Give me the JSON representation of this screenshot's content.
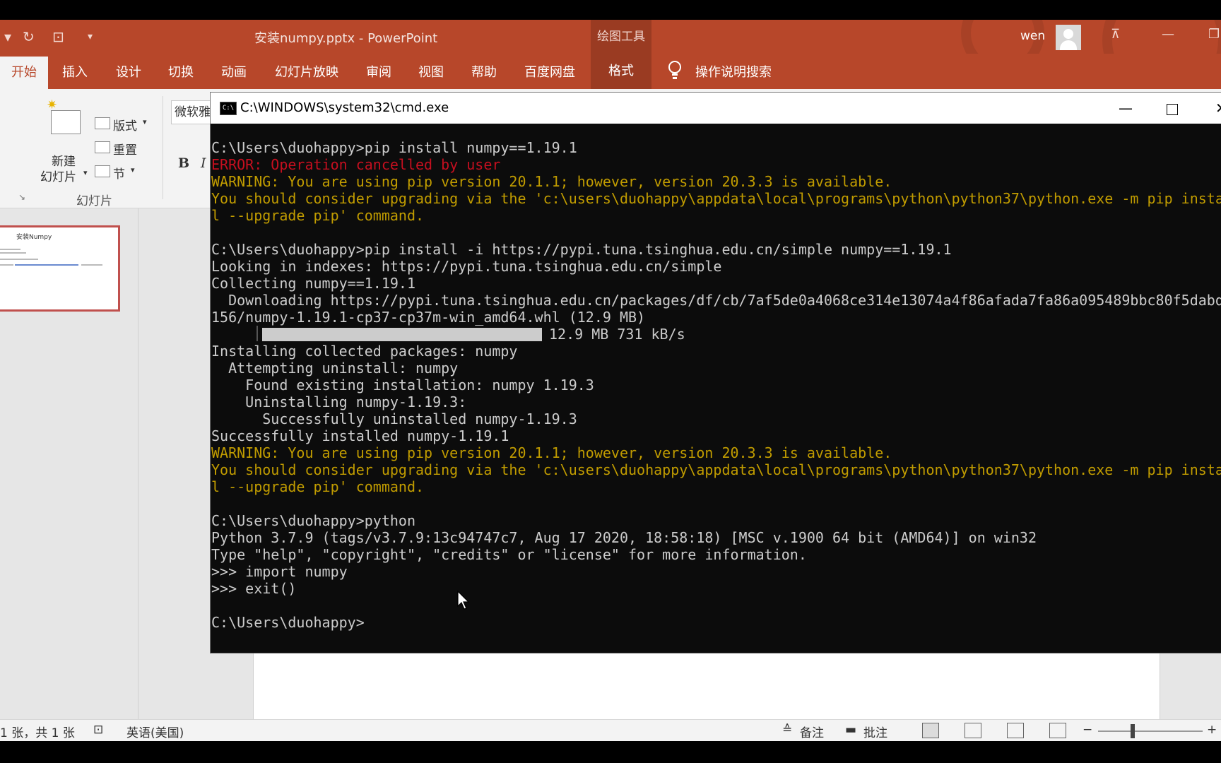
{
  "titlebar": {
    "document_title": "安装numpy.pptx  -  PowerPoint",
    "context_tool": "绘图工具",
    "user": "wen"
  },
  "ribbon_tabs": [
    "开始",
    "插入",
    "设计",
    "切换",
    "动画",
    "幻灯片放映",
    "审阅",
    "视图",
    "帮助",
    "百度网盘",
    "格式"
  ],
  "search_label": "操作说明搜索",
  "ribbon": {
    "new_slide_line1": "新建",
    "new_slide_line2": "幻灯片",
    "layout": "版式",
    "reset": "重置",
    "section": "节",
    "group_slides": "幻灯片",
    "font_name": "微软雅黑",
    "bold": "B",
    "italic": "I"
  },
  "thumbnail": {
    "title": "安装Numpy"
  },
  "statusbar": {
    "slide_count": "1 张，共 1 张",
    "language": "英语(美国)",
    "notes": "备注",
    "comments": "批注",
    "zoom_minus": "−",
    "zoom_plus": "+"
  },
  "cmd": {
    "title": "C:\\WINDOWS\\system32\\cmd.exe",
    "lines": [
      {
        "text": "C:\\Users\\duohappy>pip install numpy==1.19.1",
        "style": "normal"
      },
      {
        "text": "ERROR: Operation cancelled by user",
        "style": "err"
      },
      {
        "text": "WARNING: You are using pip version 20.1.1; however, version 20.3.3 is available.",
        "style": "warn"
      },
      {
        "text": "You should consider upgrading via the 'c:\\users\\duohappy\\appdata\\local\\programs\\python\\python37\\python.exe -m pip insta",
        "style": "warn"
      },
      {
        "text": "l --upgrade pip' command.",
        "style": "warn"
      },
      {
        "text": "",
        "style": "normal"
      },
      {
        "text": "C:\\Users\\duohappy>pip install -i https://pypi.tuna.tsinghua.edu.cn/simple numpy==1.19.1",
        "style": "normal"
      },
      {
        "text": "Looking in indexes: https://pypi.tuna.tsinghua.edu.cn/simple",
        "style": "normal"
      },
      {
        "text": "Collecting numpy==1.19.1",
        "style": "normal"
      },
      {
        "text": "  Downloading https://pypi.tuna.tsinghua.edu.cn/packages/df/cb/7af5de0a4068ce314e13074a4f86afada7fa86a095489bbc80f5dabd",
        "style": "normal"
      },
      {
        "text": "156/numpy-1.19.1-cp37-cp37m-win_amd64.whl (12.9 MB)",
        "style": "normal"
      },
      {
        "text": "",
        "style": "progress"
      },
      {
        "text": "Installing collected packages: numpy",
        "style": "normal"
      },
      {
        "text": "  Attempting uninstall: numpy",
        "style": "normal"
      },
      {
        "text": "    Found existing installation: numpy 1.19.3",
        "style": "normal"
      },
      {
        "text": "    Uninstalling numpy-1.19.3:",
        "style": "normal"
      },
      {
        "text": "      Successfully uninstalled numpy-1.19.3",
        "style": "normal"
      },
      {
        "text": "Successfully installed numpy-1.19.1",
        "style": "normal"
      },
      {
        "text": "WARNING: You are using pip version 20.1.1; however, version 20.3.3 is available.",
        "style": "warn"
      },
      {
        "text": "You should consider upgrading via the 'c:\\users\\duohappy\\appdata\\local\\programs\\python\\python37\\python.exe -m pip insta",
        "style": "warn"
      },
      {
        "text": "l --upgrade pip' command.",
        "style": "warn"
      },
      {
        "text": "",
        "style": "normal"
      },
      {
        "text": "C:\\Users\\duohappy>python",
        "style": "normal"
      },
      {
        "text": "Python 3.7.9 (tags/v3.7.9:13c94747c7, Aug 17 2020, 18:58:18) [MSC v.1900 64 bit (AMD64)] on win32",
        "style": "normal"
      },
      {
        "text": "Type \"help\", \"copyright\", \"credits\" or \"license\" for more information.",
        "style": "normal"
      },
      {
        "text": ">>> import numpy",
        "style": "normal"
      },
      {
        "text": ">>> exit()",
        "style": "normal"
      },
      {
        "text": "",
        "style": "normal"
      },
      {
        "text": "C:\\Users\\duohappy>",
        "style": "normal"
      }
    ],
    "progress": {
      "fraction": 1.0,
      "label": "12.9 MB 731 kB/s"
    }
  },
  "colors": {
    "ppt_accent": "#b7472a",
    "terminal_bg": "#0c0c0c",
    "terminal_fg": "#cccccc",
    "error": "#c50f1f",
    "warning": "#c19c00"
  }
}
